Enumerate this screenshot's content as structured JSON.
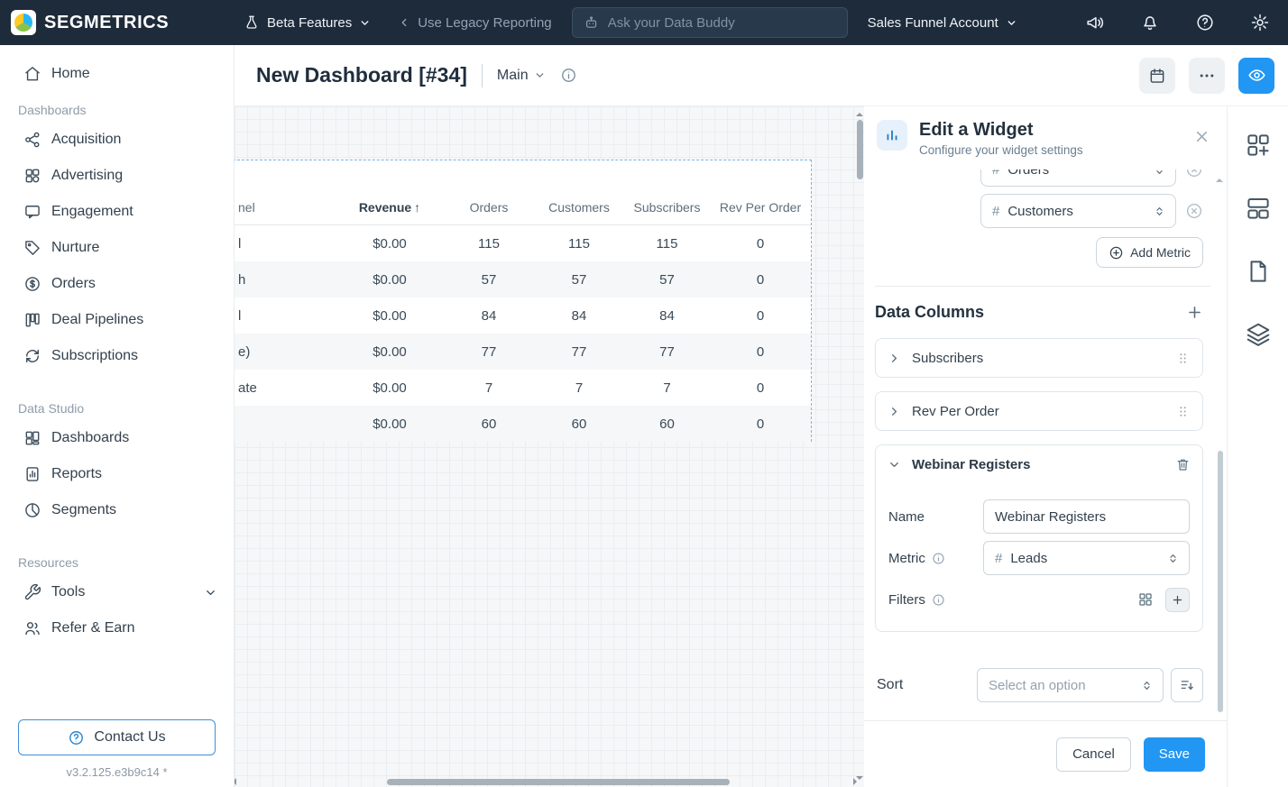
{
  "colors": {
    "accent": "#2196f3",
    "topbar_bg": "#1d2b3b"
  },
  "topbar": {
    "logo": "SEGMETRICS",
    "beta_features": "Beta Features",
    "legacy_reporting": "Use Legacy Reporting",
    "data_buddy_placeholder": "Ask your Data Buddy",
    "account": "Sales Funnel Account"
  },
  "sidebar": {
    "home": "Home",
    "sections": [
      {
        "label": "Dashboards",
        "items": [
          {
            "label": "Acquisition"
          },
          {
            "label": "Advertising"
          },
          {
            "label": "Engagement"
          },
          {
            "label": "Nurture"
          },
          {
            "label": "Orders"
          },
          {
            "label": "Deal Pipelines"
          },
          {
            "label": "Subscriptions"
          }
        ]
      },
      {
        "label": "Data Studio",
        "items": [
          {
            "label": "Dashboards"
          },
          {
            "label": "Reports"
          },
          {
            "label": "Segments"
          }
        ]
      },
      {
        "label": "Resources",
        "items": [
          {
            "label": "Tools"
          },
          {
            "label": "Refer & Earn"
          }
        ]
      }
    ],
    "contact": "Contact Us",
    "version": "v3.2.125.e3b9c14 *"
  },
  "header": {
    "title": "New Dashboard [#34]",
    "view": "Main"
  },
  "canvas": {
    "table": {
      "col_funnel_fragment": "nel",
      "col_revenue": "Revenue",
      "sort_arrow": "↑",
      "col_orders": "Orders",
      "col_customers": "Customers",
      "col_subscribers": "Subscribers",
      "col_rpo": "Rev Per Order",
      "rows": [
        {
          "label": "l",
          "revenue": "$0.00",
          "orders": "115",
          "customers": "115",
          "subscribers": "115",
          "rpo": "0"
        },
        {
          "label": "h",
          "revenue": "$0.00",
          "orders": "57",
          "customers": "57",
          "subscribers": "57",
          "rpo": "0"
        },
        {
          "label": "l",
          "revenue": "$0.00",
          "orders": "84",
          "customers": "84",
          "subscribers": "84",
          "rpo": "0"
        },
        {
          "label": "e)",
          "revenue": "$0.00",
          "orders": "77",
          "customers": "77",
          "subscribers": "77",
          "rpo": "0"
        },
        {
          "label": "ate",
          "revenue": "$0.00",
          "orders": "7",
          "customers": "7",
          "subscribers": "7",
          "rpo": "0"
        },
        {
          "label": "",
          "revenue": "$0.00",
          "orders": "60",
          "customers": "60",
          "subscribers": "60",
          "rpo": "0"
        }
      ]
    }
  },
  "panel": {
    "title": "Edit a Widget",
    "subtitle": "Configure your widget settings",
    "hash": "#",
    "metrics": [
      {
        "name": "Orders"
      },
      {
        "name": "Customers"
      }
    ],
    "add_metric": "Add Metric",
    "data_columns": "Data Columns",
    "columns": [
      {
        "name": "Subscribers"
      },
      {
        "name": "Rev Per Order"
      },
      {
        "name": "Webinar Registers"
      }
    ],
    "webinar": {
      "name_label": "Name",
      "name_value": "Webinar Registers",
      "metric_label": "Metric",
      "metric_value": "Leads",
      "filters_label": "Filters"
    },
    "sort_label": "Sort",
    "sort_placeholder": "Select an option",
    "cancel": "Cancel",
    "save": "Save"
  }
}
